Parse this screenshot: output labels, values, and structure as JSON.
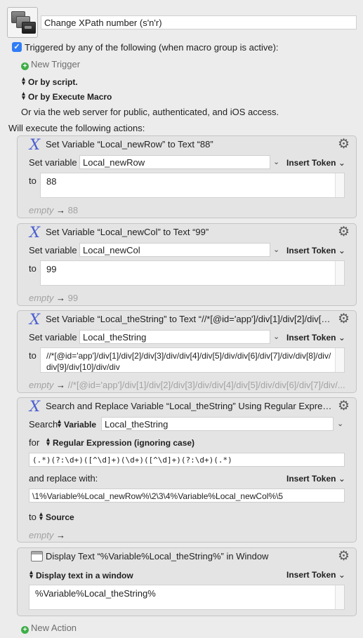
{
  "macro": {
    "name": "Change XPath number (s'n'r)",
    "trigger_label": "Triggered by any of the following (when macro group is active):",
    "new_trigger": "New Trigger",
    "or_by_script": "Or by script.",
    "or_by_execute": "Or by Execute Macro",
    "web_server_text": "Or via the web server for public, authenticated, and iOS access.",
    "will_execute": "Will execute the following actions:",
    "new_action": "New Action"
  },
  "common": {
    "set_variable": "Set variable",
    "to": "to",
    "insert_token": "Insert Token",
    "empty": "empty",
    "arrow": "→",
    "chevron": "⌄"
  },
  "actions": [
    {
      "title": "Set Variable “Local_newRow” to Text “88”",
      "variable": "Local_newRow",
      "text": "88",
      "preview": "88"
    },
    {
      "title": "Set Variable “Local_newCol” to Text “99”",
      "variable": "Local_newCol",
      "text": "99",
      "preview": "99"
    },
    {
      "title": "Set Variable “Local_theString” to Text “//*[@id='app']/div[1]/div[2]/div[3]/...",
      "variable": "Local_theString",
      "text_line1": "//*[@id='app']/div[1]/div[2]/div[3]/div/div[4]/div[5]/div/div[6]/div[7]/div/div[8]/div/",
      "text_line2": "div[9]/div[10]/div/div",
      "preview": "//*[@id='app']/div[1]/div[2]/div[3]/div/div[4]/div[5]/div/div[6]/div[7]/div/..."
    },
    {
      "title": "Search and Replace Variable “Local_theString” Using Regular Expression...",
      "search_label": "Search",
      "search_type": "Variable",
      "variable": "Local_theString",
      "for_label": "for",
      "match_mode": "Regular Expression (ignoring case)",
      "regex": "(.*)(?:\\d+)([^\\d]+)(\\d+)([^\\d]+)(?:\\d+)(.*)",
      "replace_label": "and replace with:",
      "replacement": "\\1%Variable%Local_newRow%\\2\\3\\4%Variable%Local_newCol%\\5",
      "to_label": "to",
      "to_target": "Source",
      "preview": ""
    },
    {
      "title": "Display Text “%Variable%Local_theString%” in Window",
      "display_mode": "Display text in a window",
      "text": "%Variable%Local_theString%"
    }
  ],
  "colors": {
    "background": "#ececec",
    "card": "#e4e4e4",
    "checkbox": "#2f7cf6",
    "add_icon": "#3fae49",
    "variable_icon": "#4b5fd0"
  },
  "icons": {
    "macro": "macro-windows-icon",
    "variable": "variable-x-icon",
    "gear": "gear-icon",
    "display": "window-icon",
    "add": "plus-circle-icon"
  }
}
